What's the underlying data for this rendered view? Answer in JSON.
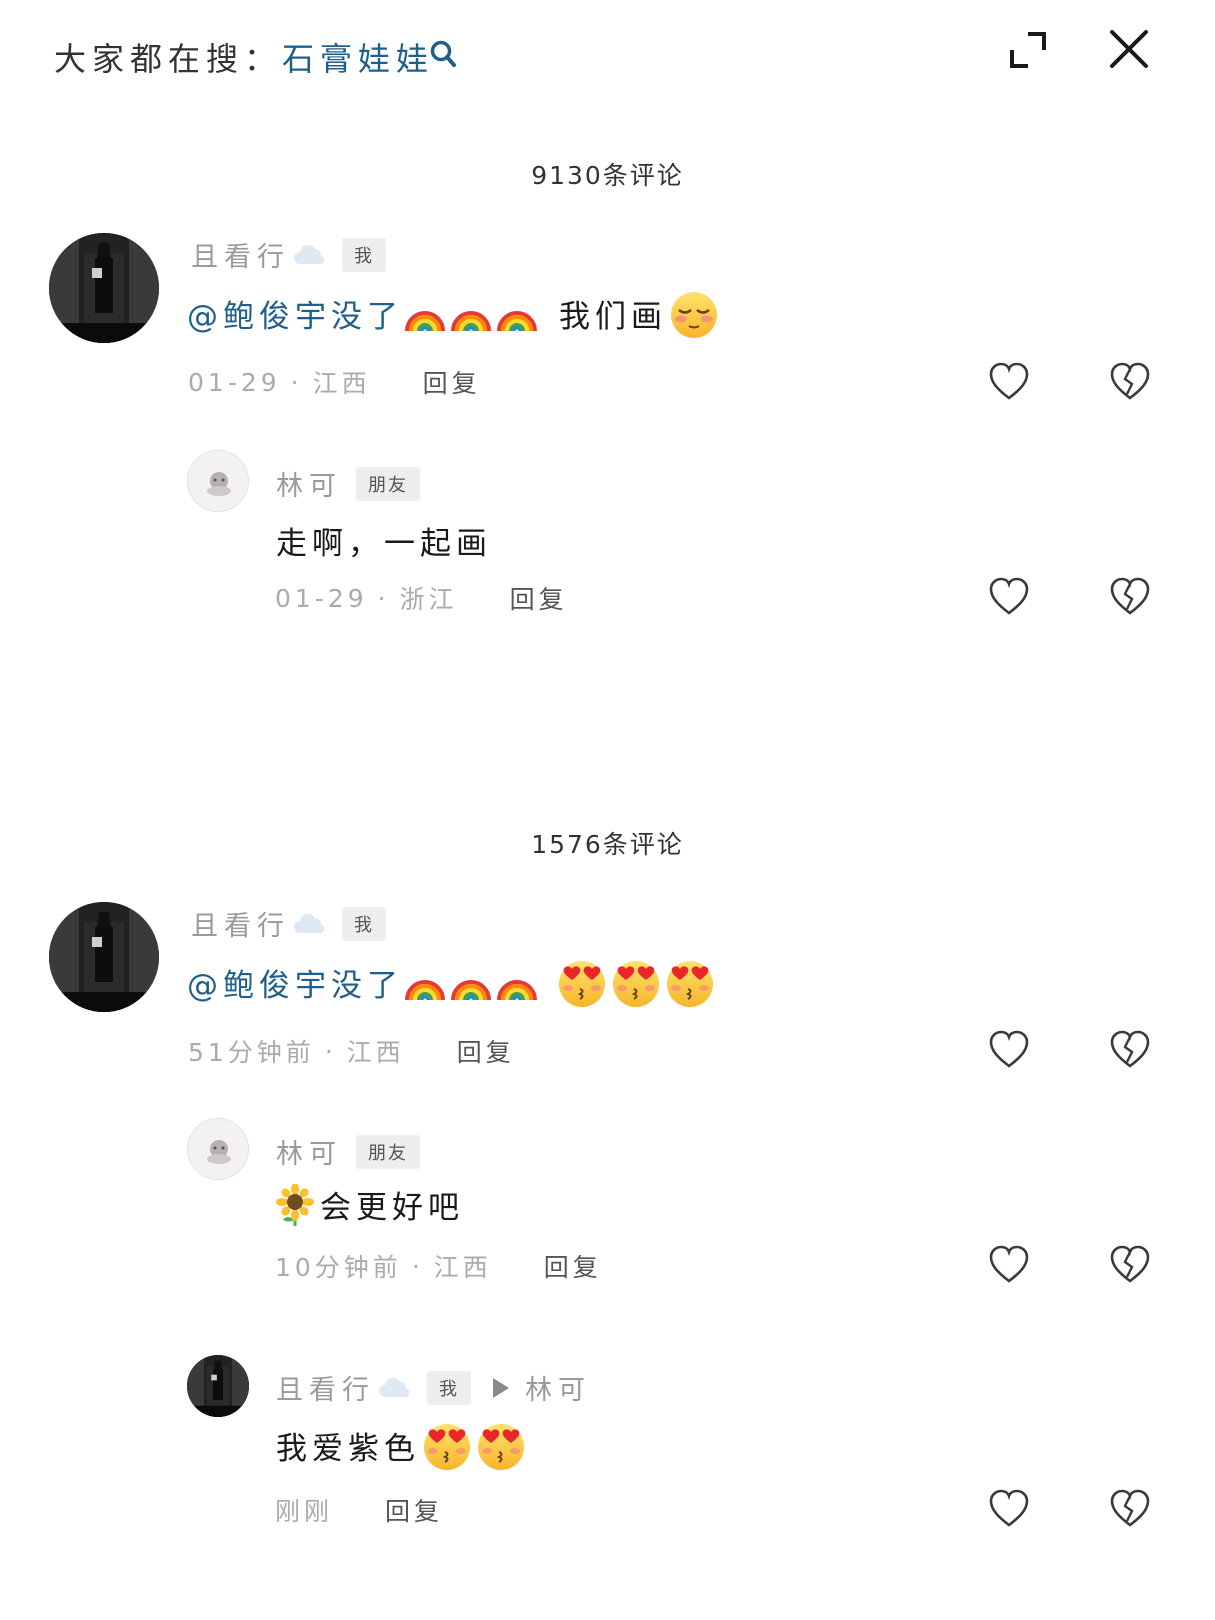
{
  "topbar": {
    "prefix": "大家都在搜：",
    "search_term": "石膏娃娃",
    "icons": [
      "search-icon",
      "expand-icon",
      "close-icon"
    ]
  },
  "sections": [
    {
      "count_label": "9130条评论",
      "comment": {
        "author": "且看行",
        "tag": "我",
        "mention": "@鲍俊宇没了",
        "text": "我们画",
        "emojis": [
          "rainbow",
          "rainbow",
          "rainbow",
          "relieved-face"
        ],
        "time": "01-29",
        "location": "江西",
        "reply_label": "回复"
      },
      "replies": [
        {
          "author": "林可",
          "tag": "朋友",
          "text": "走啊，一起画",
          "time": "01-29",
          "location": "浙江",
          "reply_label": "回复"
        }
      ]
    },
    {
      "count_label": "1576条评论",
      "comment": {
        "author": "且看行",
        "tag": "我",
        "mention": "@鲍俊宇没了",
        "emojis": [
          "rainbow",
          "rainbow",
          "rainbow",
          "heart-eyes-kiss",
          "heart-eyes-kiss",
          "heart-eyes-kiss"
        ],
        "time": "51分钟前",
        "location": "江西",
        "reply_label": "回复"
      },
      "replies": [
        {
          "author": "林可",
          "tag": "朋友",
          "text": "会更好吧",
          "emojis": [
            "sunflower"
          ],
          "time": "10分钟前",
          "location": "江西",
          "reply_label": "回复"
        },
        {
          "author": "且看行",
          "tag": "我",
          "reply_to": "林可",
          "text": "我爱紫色",
          "emojis": [
            "heart-eyes-kiss",
            "heart-eyes-kiss"
          ],
          "time": "刚刚",
          "reply_label": "回复"
        }
      ]
    }
  ],
  "meta_separator": "·",
  "colors": {
    "link": "#1f5f8c",
    "meta": "#ababab",
    "nickname": "#9a9a9a",
    "tag_bg": "#eeeeee"
  }
}
